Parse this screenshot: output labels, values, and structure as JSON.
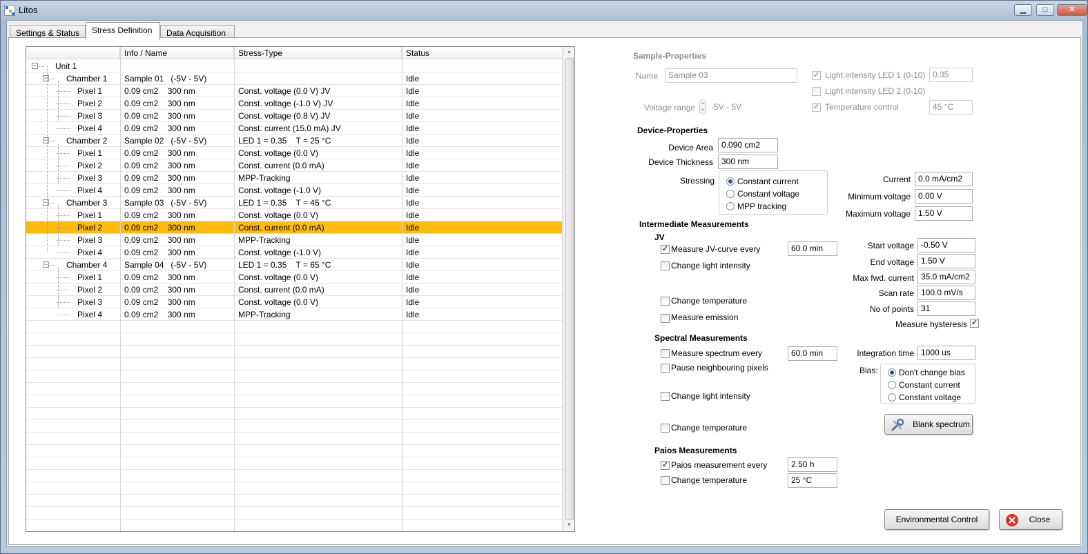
{
  "window": {
    "title": "Litos",
    "min_label": "▁",
    "max_label": "□",
    "close_label": "✕"
  },
  "tabs": [
    {
      "label": "Settings & Status",
      "active": false
    },
    {
      "label": "Stress Definition",
      "active": true
    },
    {
      "label": "Data Acquisition",
      "active": false
    }
  ],
  "tree": {
    "columns": [
      "Info / Name",
      "Stress-Type",
      "Status"
    ],
    "rows": [
      {
        "name": "Unit 1",
        "level": 0,
        "expander": true,
        "info": "",
        "stress": "",
        "status": ""
      },
      {
        "name": "Chamber 1",
        "level": 1,
        "expander": true,
        "info": "Sample 01   (-5V - 5V)",
        "stress": "",
        "status": "Idle"
      },
      {
        "name": "Pixel 1",
        "level": 2,
        "info": "0.09 cm2    300 nm",
        "stress": "Const. voltage (0.0 V) JV",
        "status": "Idle"
      },
      {
        "name": "Pixel 2",
        "level": 2,
        "info": "0.09 cm2    300 nm",
        "stress": "Const. voltage (-1.0 V) JV",
        "status": "Idle"
      },
      {
        "name": "Pixel 3",
        "level": 2,
        "info": "0.09 cm2    300 nm",
        "stress": "Const. voltage (0.8 V) JV",
        "status": "Idle"
      },
      {
        "name": "Pixel 4",
        "level": 2,
        "info": "0.09 cm2    300 nm",
        "stress": "Const. current (15.0 mA) JV",
        "status": "Idle"
      },
      {
        "name": "Chamber 2",
        "level": 1,
        "expander": true,
        "info": "Sample 02   (-5V - 5V)",
        "stress": "LED 1 = 0.35    T = 25 °C",
        "status": "Idle"
      },
      {
        "name": "Pixel 1",
        "level": 2,
        "info": "0.09 cm2    300 nm",
        "stress": "Const. voltage (0.0 V)",
        "status": "Idle"
      },
      {
        "name": "Pixel 2",
        "level": 2,
        "info": "0.09 cm2    300 nm",
        "stress": "Const. current (0.0 mA)",
        "status": "Idle"
      },
      {
        "name": "Pixel 3",
        "level": 2,
        "info": "0.09 cm2    300 nm",
        "stress": "MPP-Tracking",
        "status": "Idle"
      },
      {
        "name": "Pixel 4",
        "level": 2,
        "info": "0.09 cm2    300 nm",
        "stress": "Const. voltage (-1.0 V)",
        "status": "Idle"
      },
      {
        "name": "Chamber 3",
        "level": 1,
        "expander": true,
        "info": "Sample 03   (-5V - 5V)",
        "stress": "LED 1 = 0.35    T = 45 °C",
        "status": "Idle"
      },
      {
        "name": "Pixel 1",
        "level": 2,
        "info": "0.09 cm2    300 nm",
        "stress": "Const. voltage (0.0 V)",
        "status": "Idle"
      },
      {
        "name": "Pixel 2",
        "level": 2,
        "selected": true,
        "info": "0.09 cm2    300 nm",
        "stress": "Const. current (0.0 mA)",
        "status": "Idle"
      },
      {
        "name": "Pixel 3",
        "level": 2,
        "info": "0.09 cm2    300 nm",
        "stress": "MPP-Tracking",
        "status": "Idle"
      },
      {
        "name": "Pixel 4",
        "level": 2,
        "info": "0.09 cm2    300 nm",
        "stress": "Const. voltage (-1.0 V)",
        "status": "Idle"
      },
      {
        "name": "Chamber 4",
        "level": 1,
        "expander": true,
        "info": "Sample 04   (-5V - 5V)",
        "stress": "LED 1 = 0.35    T = 65 °C",
        "status": "Idle"
      },
      {
        "name": "Pixel 1",
        "level": 2,
        "info": "0.09 cm2    300 nm",
        "stress": "Const. voltage (0.0 V)",
        "status": "Idle"
      },
      {
        "name": "Pixel 2",
        "level": 2,
        "info": "0.09 cm2    300 nm",
        "stress": "Const. current (0.0 mA)",
        "status": "Idle"
      },
      {
        "name": "Pixel 3",
        "level": 2,
        "info": "0.09 cm2    300 nm",
        "stress": "Const. voltage (0.0 V)",
        "status": "Idle"
      },
      {
        "name": "Pixel 4",
        "level": 2,
        "info": "0.09 cm2    300 nm",
        "stress": "MPP-Tracking",
        "status": "Idle"
      }
    ],
    "selected_color": "#fdba0f"
  },
  "sample": {
    "title": "Sample-Properties",
    "name_label": "Name",
    "name_value": "Sample 03",
    "voltage_label": "Voltage range",
    "voltage_value": "-5V - 5V",
    "led1_label": "Light intensity LED 1 (0-10)",
    "led1_checked": true,
    "led1_value": "0.35",
    "led2_label": "Light intensity LED 2 (0-10)",
    "led2_checked": false,
    "temp_label": "Temperature control",
    "temp_checked": true,
    "temp_value": "45 °C"
  },
  "device": {
    "title": "Device-Properties",
    "area_label": "Device Area",
    "area_value": "0.090 cm2",
    "thickness_label": "Device Thickness",
    "thickness_value": "300 nm",
    "stressing_label": "Stressing",
    "stress_options": [
      "Constant current",
      "Constant voltage",
      "MPP tracking"
    ],
    "stress_selected": 0,
    "current_label": "Current",
    "current_value": "0.0 mA/cm2",
    "minv_label": "Minimum voltage",
    "minv_value": "0.00 V",
    "maxv_label": "Maximum voltage",
    "maxv_value": "1.50 V"
  },
  "intermediate": {
    "title": "Intermediate Measurements",
    "jv_title": "JV",
    "jv_every_label": "Measure JV-curve every",
    "jv_every_checked": true,
    "jv_every_value": "60.0 min",
    "jv_light_label": "Change light intensity",
    "jv_temp_label": "Change temperature",
    "jv_emission_label": "Measure emission",
    "start_label": "Start voltage",
    "start_value": "-0.50 V",
    "end_label": "End voltage",
    "end_value": "1.50 V",
    "maxfwd_label": "Max fwd. current",
    "maxfwd_value": "35.0 mA/cm2",
    "scan_label": "Scan rate",
    "scan_value": "100.0 mV/s",
    "points_label": "No of points",
    "points_value": "31",
    "hysteresis_label": "Measure hysteresis",
    "hysteresis_checked": true
  },
  "spectral": {
    "title": "Spectral Measurements",
    "every_label": "Measure spectrum every",
    "every_value": "60.0 min",
    "pause_label": "Pause neighbouring pixels",
    "light_label": "Change light intensity",
    "temp_label": "Change temperature",
    "integration_label": "Integration time",
    "integration_value": "1000 us",
    "bias_label": "Bias:",
    "bias_options": [
      "Don't change bias",
      "Constant current",
      "Constant voltage"
    ],
    "bias_selected": 0,
    "blank_label": "Blank spectrum"
  },
  "paios": {
    "title": "Paios Measurements",
    "every_label": "Paios measurement every",
    "every_checked": true,
    "every_value": "2.50 h",
    "temp_label": "Change temperature",
    "temp_value": "25 °C"
  },
  "footer": {
    "env_label": "Environmental Control",
    "close_label": "Close"
  },
  "icons": {
    "wrench": "wrench-icon",
    "close": "close-circle-icon"
  }
}
